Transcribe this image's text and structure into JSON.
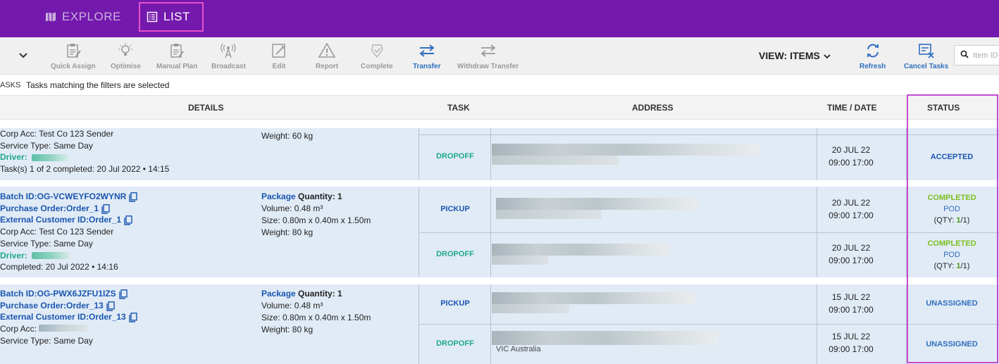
{
  "nav": {
    "explore_label": "EXPLORE",
    "list_label": "LIST"
  },
  "toolbar": {
    "quick_assign": "Quick Assign",
    "optimise": "Optimise",
    "manual_plan": "Manual Plan",
    "broadcast": "Broadcast",
    "edit": "Edit",
    "report": "Report",
    "complete": "Complete",
    "transfer": "Transfer",
    "withdraw_transfer": "Withdraw Transfer",
    "view_label": "VIEW: ITEMS",
    "refresh": "Refresh",
    "cancel_tasks": "Cancel Tasks",
    "search_placeholder": "Item ID"
  },
  "notice": {
    "prefix": "ASKS",
    "message": "Tasks matching the filters are selected"
  },
  "columns": {
    "details": "DETAILS",
    "task": "TASK",
    "address": "ADDRESS",
    "time_date": "TIME / DATE",
    "status": "STATUS"
  },
  "groups": [
    {
      "corp_acc": "Corp Acc: Test Co 123 Sender",
      "service_type": "Service Type: Same Day",
      "driver_label": "Driver:",
      "summary": "Task(s) 1 of 2 completed: 20 Jul 2022 • 14:15",
      "weight": "Weight: 60 kg",
      "tasks": [
        {
          "type": "DROPOFF",
          "date": "20 JUL 22",
          "time": "09:00 17:00",
          "status": "ACCEPTED"
        }
      ]
    },
    {
      "batch_id": "Batch ID:OG-VCWEYFO2WYNR",
      "purchase_order": "Purchase Order:Order_1",
      "external_id": "External Customer ID:Order_1",
      "corp_acc": "Corp Acc: Test Co 123 Sender",
      "service_type": "Service Type: Same Day",
      "driver_label": "Driver:",
      "summary": "Completed: 20 Jul 2022 • 14:16",
      "package_word": "Package",
      "quantity": "Quantity: 1",
      "volume": "Volume: 0.48 m³",
      "size": "Size: 0.80m x 0.40m x 1.50m",
      "weight": "Weight: 80 kg",
      "tasks": [
        {
          "type": "PICKUP",
          "date": "20 JUL 22",
          "time": "09:00 17:00",
          "status": "COMPLETED",
          "sub": "POD",
          "qty_pre": "(QTY: ",
          "qty_done": "1",
          "qty_post": "/1)"
        },
        {
          "type": "DROPOFF",
          "date": "20 JUL 22",
          "time": "09:00 17:00",
          "status": "COMPLETED",
          "sub": "POD",
          "qty_pre": "(QTY: ",
          "qty_done": "1",
          "qty_post": "/1)"
        }
      ]
    },
    {
      "batch_id": "Batch ID:OG-PWX6JZFU1IZS",
      "purchase_order": "Purchase Order:Order_13",
      "external_id": "External Customer ID:Order_13",
      "corp_acc": "Corp Acc:",
      "service_type": "Service Type: Same Day",
      "package_word": "Package",
      "quantity": "Quantity: 1",
      "volume": "Volume: 0.48 m³",
      "size": "Size: 0.80m x 0.40m x 1.50m",
      "weight": "Weight: 80 kg",
      "tasks": [
        {
          "type": "PICKUP",
          "date": "15 JUL 22",
          "time": "09:00 17:00",
          "status": "UNASSIGNED"
        },
        {
          "type": "DROPOFF",
          "date": "15 JUL 22",
          "time": "09:00 17:00",
          "status": "UNASSIGNED",
          "address_tail": "VIC Australia"
        }
      ]
    }
  ],
  "colors": {
    "topbar": "#7419ad",
    "highlight": "#c44bd0",
    "link_blue": "#1a56b0",
    "teal": "#1ea88c",
    "completed_green": "#7bbf1d",
    "row_bg": "#e1ebf6"
  }
}
